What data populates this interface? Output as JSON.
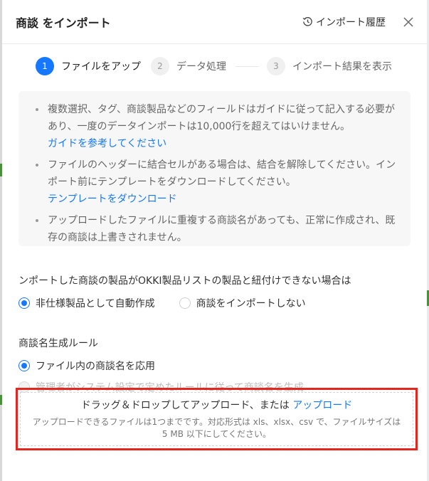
{
  "header": {
    "title": "商談 をインポート",
    "history_label": "インポート履歴"
  },
  "steps": [
    {
      "num": "1",
      "label": "ファイルをアップ",
      "state": "active"
    },
    {
      "num": "2",
      "label": "データ処理",
      "state": "inactive"
    },
    {
      "num": "3",
      "label": "インポート結果を表示",
      "state": "inactive"
    }
  ],
  "info": {
    "item1": "複数選択、タグ、商談製品などのフィールドはガイドに従って記入する必要があり、一度のデータインポートは10,000行を超えてはいけません。",
    "item1_link": "ガイドを参考してください",
    "item2": "ファイルのヘッダーに結合セルがある場合は、結合を解除してください。インポート前にテンプレートをダウンロードしてください。",
    "item2_link": "テンプレートをダウンロード",
    "item3": "アップロードしたファイルに重複する商談名があっても、正常に作成され、既存の商談は上書きされません。"
  },
  "product_option": {
    "question": "ンポートした商談の製品がOKKI製品リストの製品と紐付けできない場合は",
    "options": [
      "非仕様製品として自動作成",
      "商談をインポートしない"
    ],
    "selected": "非仕様製品として自動作成"
  },
  "name_rule": {
    "question": "商談名生成ルール",
    "options": [
      "ファイル内の商談名を応用",
      "管理者がシステム設定で定めたルールに従って商談名を生成"
    ],
    "selected": "ファイル内の商談名を応用"
  },
  "upload": {
    "main_text": "ドラッグ＆ドロップしてアップロード、または ",
    "link_text": "アップロード",
    "sub_text": "アップロードできるファイルは1つまでです。対応形式は xls、xlsx、csv で、ファイルサイズは 5 MB 以下にしてください。"
  },
  "colors": {
    "accent": "#1677ff",
    "highlight_border": "#e5261f"
  },
  "icons": {
    "history": "history-clock-icon",
    "close": "close-icon"
  }
}
